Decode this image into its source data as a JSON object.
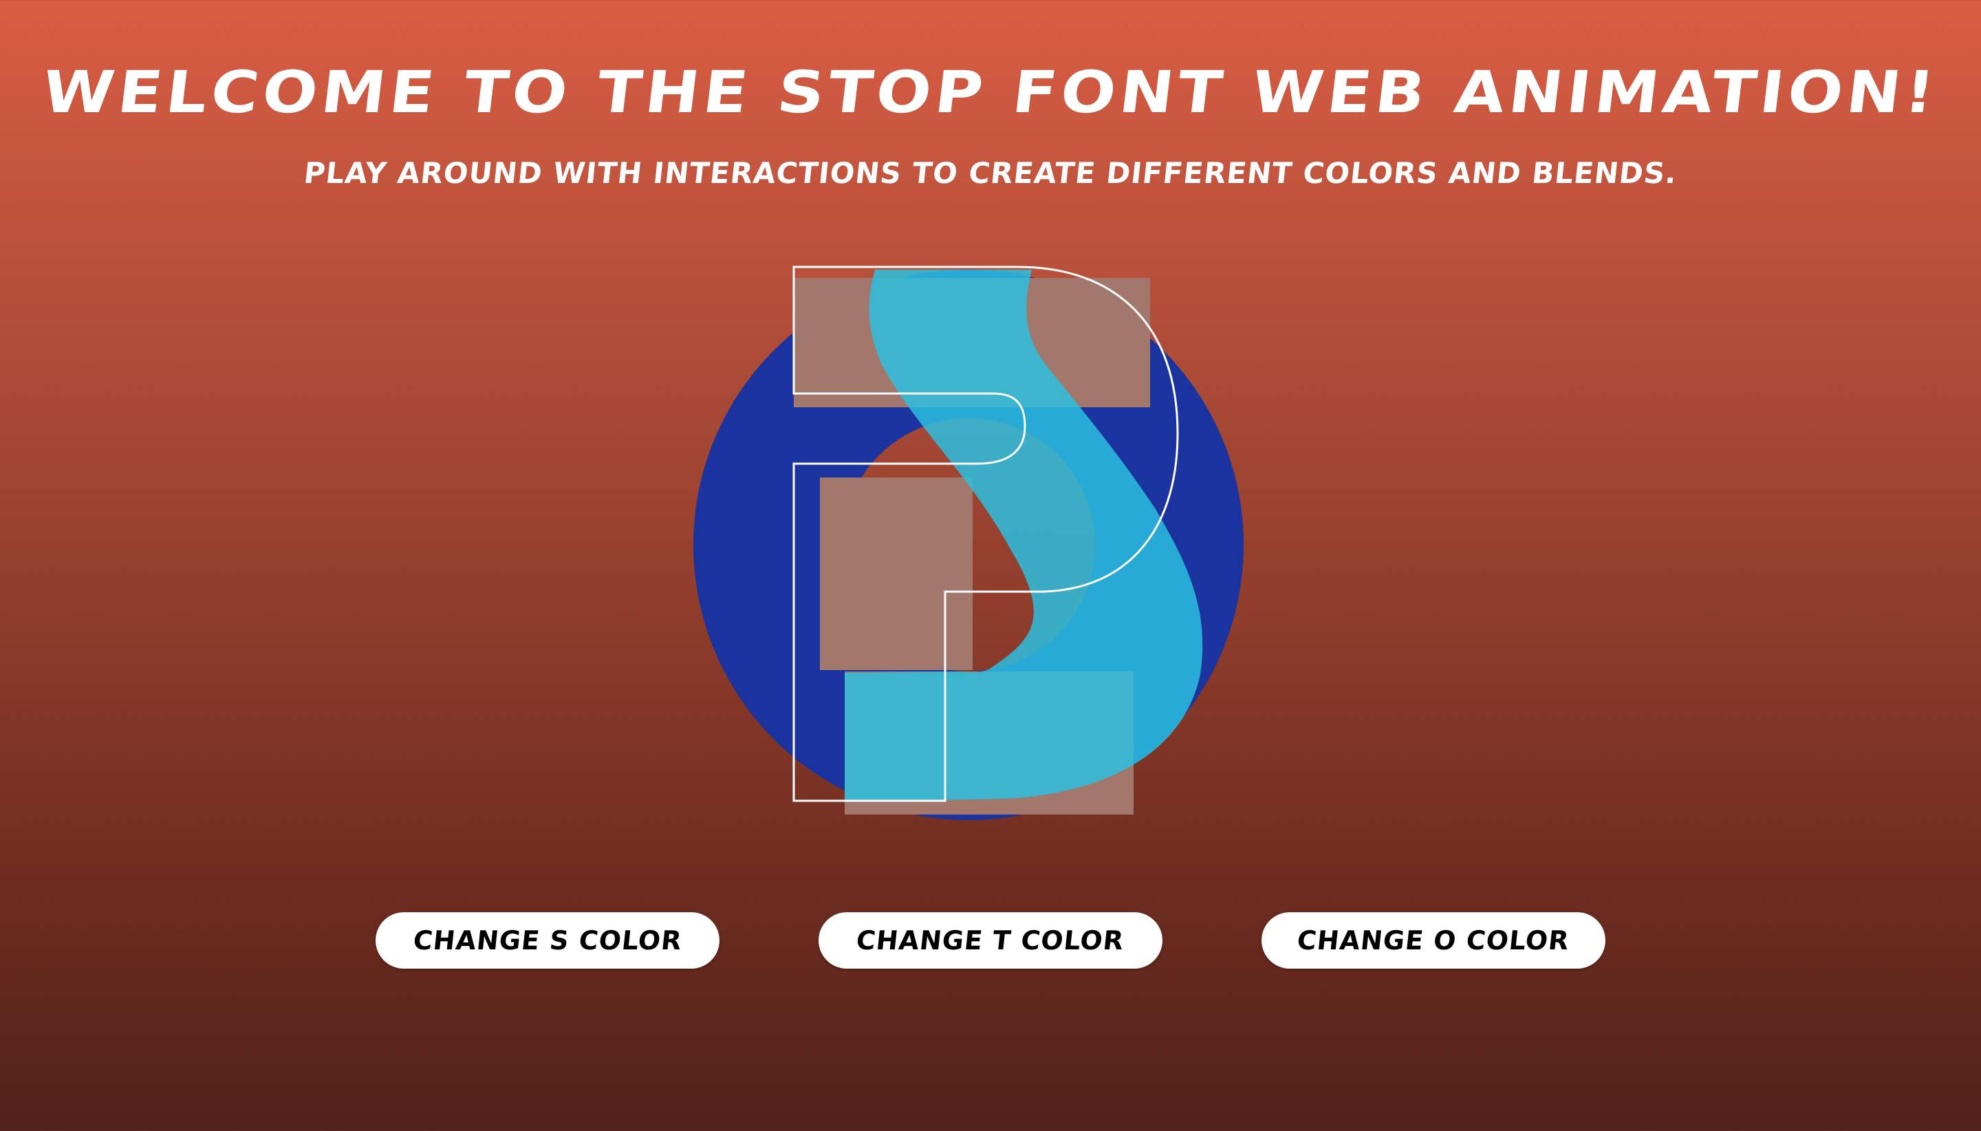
{
  "page": {
    "title": "Welcome to the Stop Font Web Animation!",
    "subtitle": "Play around with interactions to create different colors and blends."
  },
  "buttons": {
    "change_s": "Change S color",
    "change_t": "Change T color",
    "change_o": "Change O color"
  },
  "artwork": {
    "letters": [
      "S",
      "T",
      "O",
      "P"
    ],
    "colors": {
      "background_top": "#d95d43",
      "background_bottom": "#52221a",
      "o_letter": "#1a339e",
      "t_letter": "#7a4a12",
      "t_overlay": "#8a72b0",
      "s_letter": "#2bc0df",
      "p_outline": "#ffffff",
      "button_bg": "#ffffff",
      "button_text": "#000000"
    }
  }
}
